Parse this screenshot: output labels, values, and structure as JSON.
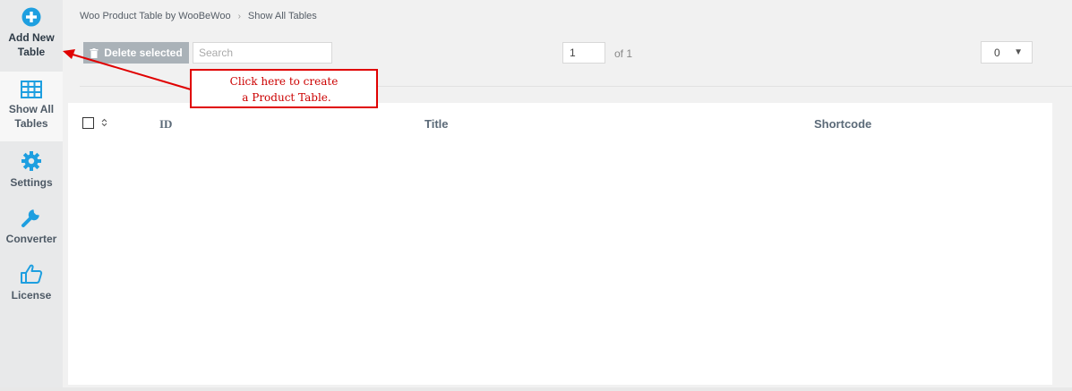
{
  "sidebar": {
    "items": [
      {
        "label_line1": "Add New",
        "label_line2": "Table",
        "icon": "plus-circle-icon"
      },
      {
        "label_line1": "Show All",
        "label_line2": "Tables",
        "icon": "table-grid-icon"
      },
      {
        "label_line1": "Settings",
        "icon": "gear-icon"
      },
      {
        "label_line1": "Converter",
        "icon": "wrench-icon"
      },
      {
        "label_line1": "License",
        "icon": "thumbs-up-icon"
      }
    ]
  },
  "breadcrumb": {
    "root": "Woo Product Table by WooBeWoo",
    "current": "Show All Tables"
  },
  "toolbar": {
    "delete_label": "Delete selected",
    "search_placeholder": "Search",
    "page_value": "1",
    "page_of": "of 1",
    "per_page_value": "0"
  },
  "table": {
    "columns": [
      "ID",
      "Title",
      "Shortcode"
    ]
  },
  "annotation": {
    "line1": "Click here to create",
    "line2": "a Product Table."
  },
  "colors": {
    "accent": "#1e9fe0",
    "annotation": "#e00000"
  }
}
